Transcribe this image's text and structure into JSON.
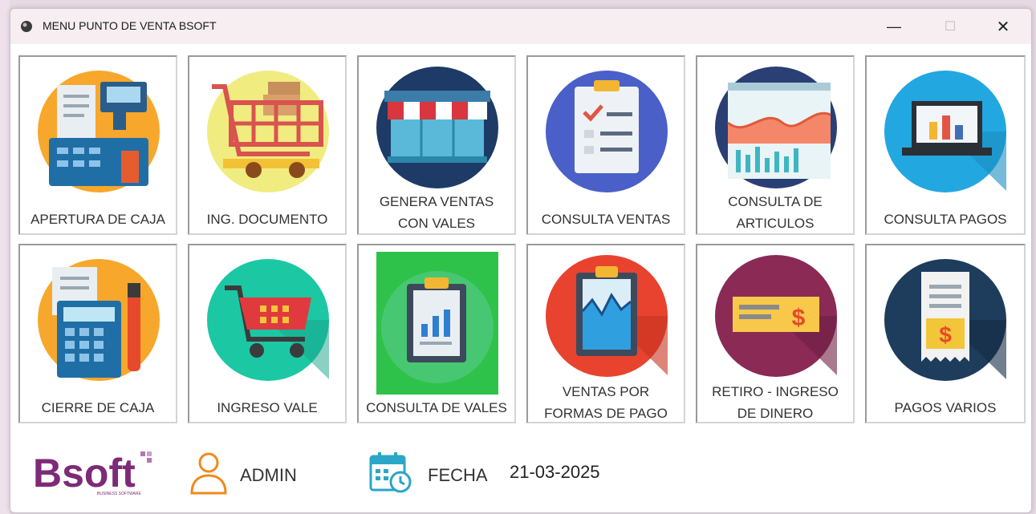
{
  "window": {
    "title": "MENU PUNTO DE VENTA BSOFT",
    "controls": {
      "minimize": "—",
      "maximize": "☐",
      "close": "✕"
    }
  },
  "tiles_row1": [
    {
      "label": "APERTURA DE CAJA",
      "icon": "cash-register-icon"
    },
    {
      "label": "ING. DOCUMENTO",
      "icon": "shopping-cart-icon"
    },
    {
      "label_line1": "GENERA VENTAS",
      "label_line2": "CON VALES",
      "icon": "storefront-icon"
    },
    {
      "label": "CONSULTA VENTAS",
      "icon": "clipboard-checklist-icon"
    },
    {
      "label_line1": "CONSULTA DE",
      "label_line2": "ARTICULOS",
      "icon": "analytics-chart-icon"
    },
    {
      "label": "CONSULTA PAGOS",
      "icon": "laptop-chart-icon"
    }
  ],
  "tiles_row2": [
    {
      "label": "CIERRE DE CAJA",
      "icon": "calculator-icon"
    },
    {
      "label": "INGRESO VALE",
      "icon": "cart-icon"
    },
    {
      "label": "CONSULTA DE VALES",
      "icon": "report-clipboard-icon"
    },
    {
      "label_line1": "VENTAS POR",
      "label_line2": "FORMAS DE PAGO",
      "icon": "chart-clipboard-icon"
    },
    {
      "label_line1": "RETIRO - INGRESO",
      "label_line2": "DE DINERO",
      "icon": "check-money-icon"
    },
    {
      "label": "PAGOS VARIOS",
      "icon": "receipt-dollar-icon"
    }
  ],
  "footer": {
    "logo_text": "Bsoft",
    "logo_tagline": "BUSINESS SOFTWARE",
    "user": "ADMIN",
    "fecha_label": "FECHA",
    "fecha_value": "21-03-2025"
  },
  "colors": {
    "titlebar": "#f6eef1",
    "selected_tile": "#2fc24a",
    "logo_purple": "#7d2a78",
    "user_icon": "#f08a1c",
    "calendar_icon": "#2aa6c6"
  }
}
